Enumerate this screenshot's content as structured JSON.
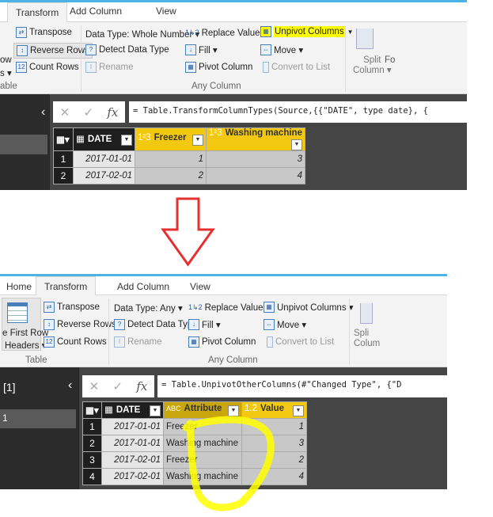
{
  "top": {
    "tabs": [
      "Transform",
      "Add Column",
      "View"
    ],
    "active_tab": "Transform",
    "ribbon": {
      "partial_left": [
        "ow",
        "s ▾"
      ],
      "table_group_partial": "able",
      "transpose": "Transpose",
      "reverse_rows": "Reverse Rows",
      "count_rows": "Count Rows",
      "data_type": "Data Type: Whole Number ▾",
      "detect_data_type": "Detect Data Type",
      "rename": "Rename",
      "replace_values": "Replace Values ▾",
      "fill": "Fill ▾",
      "pivot_column": "Pivot Column",
      "unpivot_columns": "Unpivot Columns",
      "move": "Move ▾",
      "convert_to_list": "Convert to List",
      "any_column_group": "Any Column",
      "split_column": [
        "Split",
        "Column ▾"
      ],
      "partial_right": "Fo"
    },
    "formula": "= Table.TransformColumnTypes(Source,{{\"DATE\", type date}, {",
    "table": {
      "columns": [
        {
          "name": "DATE",
          "type": "date"
        },
        {
          "name": "Freezer",
          "type": "1²3"
        },
        {
          "name": "Washing machine",
          "type": "1²3"
        }
      ],
      "rows": [
        [
          "1",
          "2017-01-01",
          "1",
          "3"
        ],
        [
          "2",
          "2017-02-01",
          "2",
          "4"
        ]
      ]
    },
    "highlight_color": "#ffff00"
  },
  "arrow_color": "#e53030",
  "bottom": {
    "tabs": [
      "Home",
      "Transform",
      "Add Column",
      "View"
    ],
    "active_tab": "Transform",
    "ribbon": {
      "first_row_headers": [
        "e First Row",
        "Headers ▾"
      ],
      "table_group": "Table",
      "transpose": "Transpose",
      "reverse_rows": "Reverse Rows",
      "count_rows": "Count Rows",
      "data_type": "Data Type: Any ▾",
      "detect_data_type": "Detect Data Type",
      "rename": "Rename",
      "replace_values": "Replace Values ▾",
      "fill": "Fill ▾",
      "pivot_column": "Pivot Column",
      "unpivot_columns": "Unpivot Columns ▾",
      "move": "Move ▾",
      "convert_to_list": "Convert to List",
      "any_column_group": "Any Column",
      "split_column": [
        "Spli",
        "Colum"
      ]
    },
    "query_partial": "[1]",
    "query_item_partial": "1",
    "formula": "= Table.UnpivotOtherColumns(#\"Changed Type\", {\"D",
    "table": {
      "columns": [
        {
          "name": "DATE",
          "type": "date"
        },
        {
          "name": "Attribute",
          "type": "ABC"
        },
        {
          "name": "Value",
          "type": "1.2"
        }
      ],
      "rows": [
        [
          "1",
          "2017-01-01",
          "Freezer",
          "1"
        ],
        [
          "2",
          "2017-01-01",
          "Washing machine",
          "3"
        ],
        [
          "3",
          "2017-02-01",
          "Freezer",
          "2"
        ],
        [
          "4",
          "2017-02-01",
          "Washing machine",
          "4"
        ]
      ]
    }
  }
}
